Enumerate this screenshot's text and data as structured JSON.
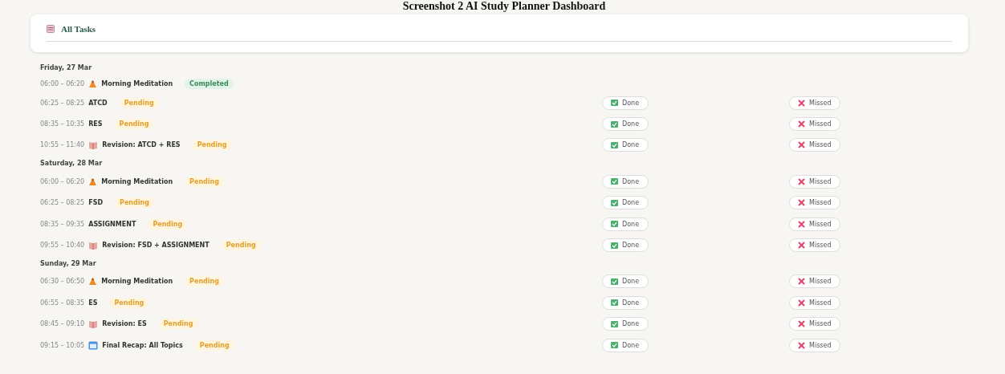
{
  "caption": "Screenshot 2 AI Study Planner Dashboard",
  "card": {
    "title": "All Tasks"
  },
  "days": [
    {
      "date": "Friday, 27 Mar",
      "tasks": [
        {
          "time": "06:00 – 06:20",
          "kind": "meditation",
          "title": "Morning Meditation",
          "completed": true,
          "badge": "Completed"
        },
        {
          "time": "06:25 – 08:25",
          "kind": "plain",
          "title": "ATCD",
          "completed": false,
          "badge": "Pending",
          "done": "Done",
          "missed": "Missed"
        },
        {
          "time": "08:35 – 10:35",
          "kind": "plain",
          "title": "RES",
          "completed": false,
          "badge": "Pending",
          "done": "Done",
          "missed": "Missed"
        },
        {
          "time": "10:55 – 11:40",
          "kind": "revision",
          "title": "Revision: ATCD + RES",
          "completed": false,
          "badge": "Pending",
          "done": "Done",
          "missed": "Missed"
        }
      ]
    },
    {
      "date": "Saturday, 28 Mar",
      "tasks": [
        {
          "time": "06:00 – 06:20",
          "kind": "meditation",
          "title": "Morning Meditation",
          "completed": false,
          "badge": "Pending",
          "done": "Done",
          "missed": "Missed"
        },
        {
          "time": "06:25 – 08:25",
          "kind": "plain",
          "title": "FSD",
          "completed": false,
          "badge": "Pending",
          "done": "Done",
          "missed": "Missed"
        },
        {
          "time": "08:35 – 09:35",
          "kind": "plain",
          "title": "ASSIGNMENT",
          "completed": false,
          "badge": "Pending",
          "done": "Done",
          "missed": "Missed"
        },
        {
          "time": "09:55 – 10:40",
          "kind": "revision",
          "title": "Revision: FSD + ASSIGNMENT",
          "completed": false,
          "badge": "Pending",
          "done": "Done",
          "missed": "Missed"
        }
      ]
    },
    {
      "date": "Sunday, 29 Mar",
      "tasks": [
        {
          "time": "06:30 – 06:50",
          "kind": "meditation",
          "title": "Morning Meditation",
          "completed": false,
          "badge": "Pending",
          "done": "Done",
          "missed": "Missed"
        },
        {
          "time": "06:55 – 08:35",
          "kind": "plain",
          "title": "ES",
          "completed": false,
          "badge": "Pending",
          "done": "Done",
          "missed": "Missed"
        },
        {
          "time": "08:45 – 09:10",
          "kind": "revision",
          "title": "Revision: ES",
          "completed": false,
          "badge": "Pending",
          "done": "Done",
          "missed": "Missed"
        },
        {
          "time": "09:15 – 10:05",
          "kind": "recap",
          "title": "Final Recap: All Topics",
          "completed": false,
          "badge": "Pending",
          "done": "Done",
          "missed": "Missed"
        }
      ]
    }
  ]
}
